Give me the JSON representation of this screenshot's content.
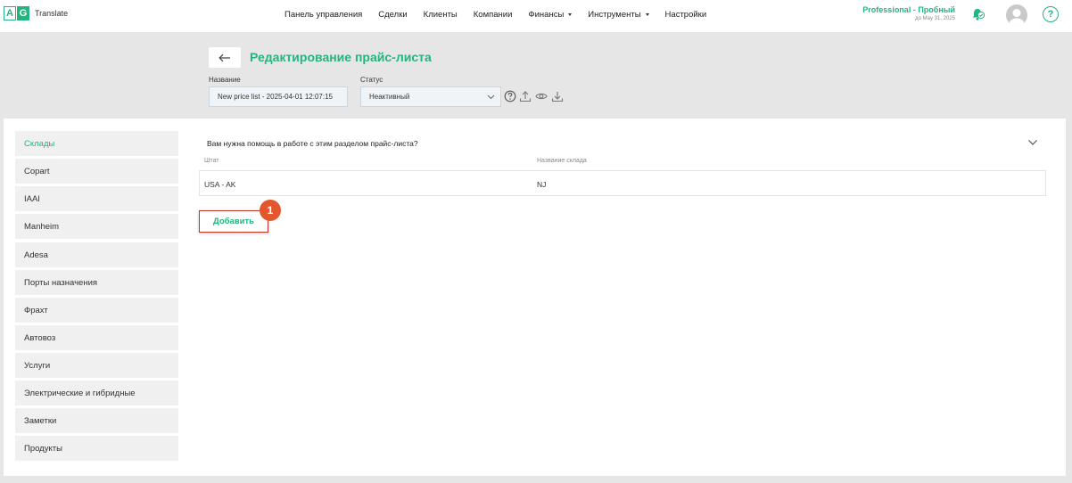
{
  "app": {
    "logo_letters": [
      "A",
      "G"
    ],
    "logo_text": "Translate",
    "brand_color": "#24b47e"
  },
  "nav": {
    "items": [
      {
        "label": "Панель управления",
        "dropdown": false
      },
      {
        "label": "Сделки",
        "dropdown": false
      },
      {
        "label": "Клиенты",
        "dropdown": false
      },
      {
        "label": "Компании",
        "dropdown": false
      },
      {
        "label": "Финансы",
        "dropdown": true
      },
      {
        "label": "Инструменты",
        "dropdown": true
      },
      {
        "label": "Настройки",
        "dropdown": false
      }
    ]
  },
  "account": {
    "plan": "Professional - Пробный",
    "plan_until": "до May 31, 2025",
    "help_glyph": "?"
  },
  "header": {
    "title": "Редактирование прайс-листа",
    "name_label": "Название",
    "name_value": "New price list - 2025-04-01 12:07:15",
    "status_label": "Статус",
    "status_value": "Неактивный"
  },
  "sidebar": {
    "items": [
      {
        "label": "Склады",
        "active": true
      },
      {
        "label": "Copart",
        "active": false
      },
      {
        "label": "IAAI",
        "active": false
      },
      {
        "label": "Manheim",
        "active": false
      },
      {
        "label": "Adesa",
        "active": false
      },
      {
        "label": "Порты назначения",
        "active": false
      },
      {
        "label": "Фрахт",
        "active": false
      },
      {
        "label": "Автовоз",
        "active": false
      },
      {
        "label": "Услуги",
        "active": false
      },
      {
        "label": "Электрические и гибридные",
        "active": false
      },
      {
        "label": "Заметки",
        "active": false
      },
      {
        "label": "Продукты",
        "active": false
      }
    ]
  },
  "content": {
    "help_question": "Вам нужна помощь в работе с этим разделом прайс-листа?",
    "columns": [
      "Штат",
      "Название склада"
    ],
    "rows": [
      [
        "USA - AK",
        "NJ"
      ]
    ],
    "add_button": "Добавить",
    "step_badge": "1"
  }
}
